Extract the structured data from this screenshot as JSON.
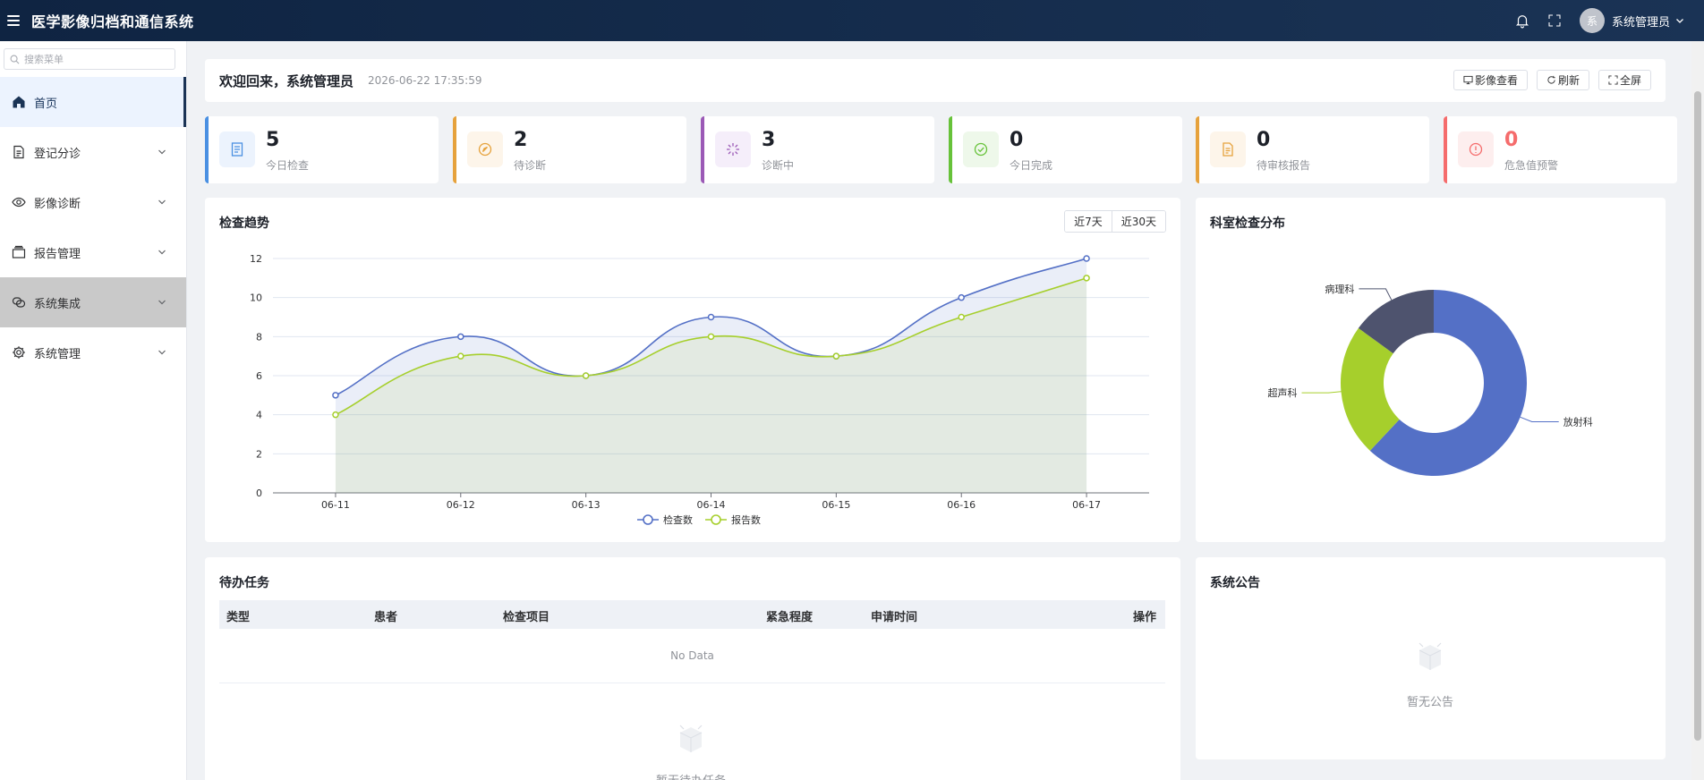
{
  "header": {
    "title": "医学影像归档和通信系统",
    "user_avatar_text": "系",
    "user_name": "系统管理员"
  },
  "sidebar": {
    "search_placeholder": "搜索菜单",
    "items": [
      {
        "label": "首页",
        "icon": "home-icon",
        "active": true
      },
      {
        "label": "登记分诊",
        "icon": "document-icon"
      },
      {
        "label": "影像诊断",
        "icon": "eye-icon"
      },
      {
        "label": "报告管理",
        "icon": "folder-icon"
      },
      {
        "label": "系统集成",
        "icon": "link-icon",
        "hover": true
      },
      {
        "label": "系统管理",
        "icon": "gear-icon"
      }
    ]
  },
  "welcome": {
    "text": "欢迎回来，系统管理员",
    "time": "2026-06-22 17:35:59",
    "buttons": [
      "影像查看",
      "刷新",
      "全屏"
    ]
  },
  "stats": [
    {
      "value": "5",
      "label": "今日检查",
      "color": "#4a90e2",
      "bg": "#ecf3fd",
      "icon": "document-icon"
    },
    {
      "value": "2",
      "label": "待诊断",
      "color": "#e6a23c",
      "bg": "#fdf5ea",
      "icon": "compass-icon"
    },
    {
      "value": "3",
      "label": "诊断中",
      "color": "#9b59b6",
      "bg": "#f5eefa",
      "icon": "loading-icon"
    },
    {
      "value": "0",
      "label": "今日完成",
      "color": "#67c23a",
      "bg": "#eef8ea",
      "icon": "check-icon"
    },
    {
      "value": "0",
      "label": "待审核报告",
      "color": "#e6a23c",
      "bg": "#fdf5ea",
      "icon": "report-icon"
    },
    {
      "value": "0",
      "label": "危急值预警",
      "color": "#f56c6c",
      "bg": "#fdeeee",
      "icon": "warning-icon"
    }
  ],
  "trend": {
    "title": "检查趋势",
    "tabs": [
      "近7天",
      "近30天"
    ]
  },
  "dept": {
    "title": "科室检查分布"
  },
  "tasks": {
    "title": "待办任务",
    "columns": [
      "类型",
      "患者",
      "检查项目",
      "紧急程度",
      "申请时间",
      "操作"
    ],
    "no_data": "No Data",
    "empty_text": "暂无待办任务"
  },
  "notice": {
    "title": "系统公告",
    "empty_text": "暂无公告"
  },
  "colors": {
    "primary": "#1a3355",
    "series1": "#5470c6",
    "series2": "#a6cf2c"
  },
  "chart_data": [
    {
      "type": "line",
      "title": "检查趋势",
      "categories": [
        "06-11",
        "06-12",
        "06-13",
        "06-14",
        "06-15",
        "06-16",
        "06-17"
      ],
      "series": [
        {
          "name": "检查数",
          "values": [
            5,
            8,
            6,
            9,
            7,
            10,
            12
          ]
        },
        {
          "name": "报告数",
          "values": [
            4,
            7,
            6,
            8,
            7,
            9,
            11
          ]
        }
      ],
      "ylim": [
        0,
        12
      ],
      "yticks": [
        0,
        2,
        4,
        6,
        8,
        10,
        12
      ],
      "grid": true,
      "legend": "bottom-center"
    },
    {
      "type": "pie",
      "title": "科室检查分布",
      "labels": [
        "放射科",
        "超声科",
        "病理科"
      ],
      "values": [
        62,
        23,
        15
      ],
      "colors": [
        "#5470c6",
        "#a6cf2c",
        "#4e536e"
      ],
      "donut": true
    }
  ]
}
